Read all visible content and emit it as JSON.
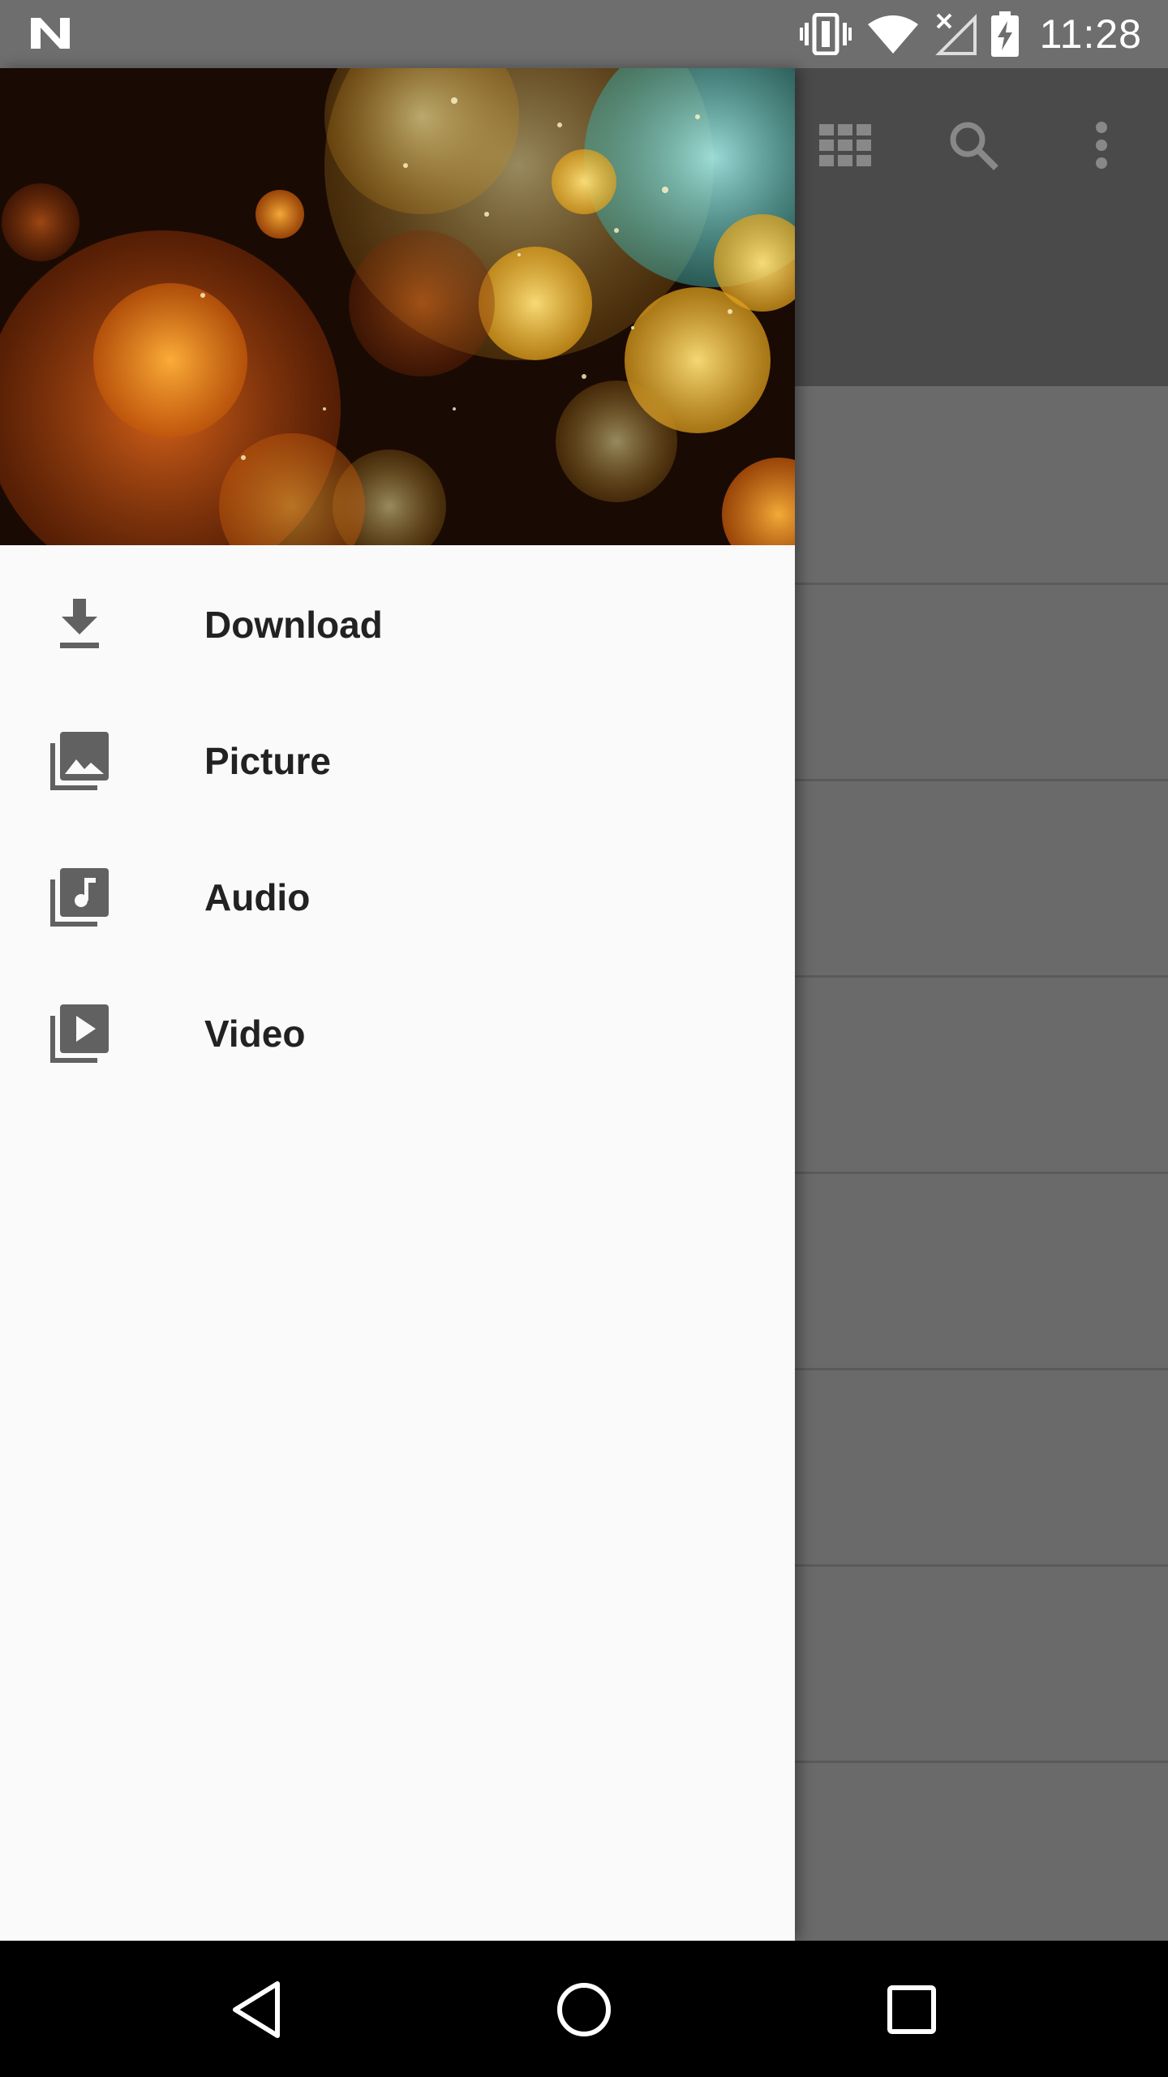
{
  "status_bar": {
    "time": "11:28",
    "icons": [
      "n-logo-icon",
      "vibrate-icon",
      "wifi-icon",
      "no-signal-icon",
      "battery-charging-icon"
    ]
  },
  "app_bar": {
    "actions": [
      "grid-view-icon",
      "search-icon",
      "more-vert-icon"
    ]
  },
  "drawer": {
    "header_image": "bokeh-lights-image",
    "items": [
      {
        "label": "Download",
        "icon": "download-icon"
      },
      {
        "label": "Picture",
        "icon": "photo-library-icon"
      },
      {
        "label": "Audio",
        "icon": "music-library-icon"
      },
      {
        "label": "Video",
        "icon": "video-library-icon"
      }
    ]
  },
  "nav_bar": {
    "buttons": [
      "back-icon",
      "home-icon",
      "recents-icon"
    ]
  },
  "colors": {
    "drawer_bg": "#fafafa",
    "scrim": "#686868",
    "appbar": "#4a4a4a",
    "icon_gray": "#616161",
    "text": "#222222"
  }
}
